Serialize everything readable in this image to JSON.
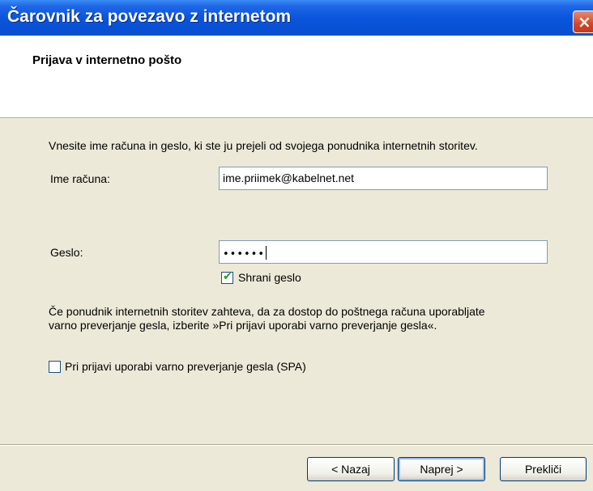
{
  "window": {
    "title": "Čarovnik za povezavo z internetom"
  },
  "header": {
    "title": "Prijava v internetno pošto"
  },
  "intro_text": "Vnesite ime računa in geslo, ki ste ju prejeli od svojega ponudnika internetnih storitev.",
  "account": {
    "label": "Ime računa:",
    "value": "ime.priimek@kabelnet.net"
  },
  "password": {
    "label": "Geslo:",
    "masked_value": "••••••"
  },
  "remember_password": {
    "label": "Shrani geslo",
    "checked": true,
    "check_glyph": "✔"
  },
  "spa_info_line1": "Če ponudnik internetnih storitev zahteva, da za dostop do poštnega računa uporabljate",
  "spa_info_line2": "varno preverjanje gesla, izberite »Pri prijavi uporabi varno preverjanje gesla«.",
  "spa_checkbox": {
    "label": "Pri prijavi uporabi varno preverjanje gesla (SPA)",
    "checked": false
  },
  "buttons": {
    "back": "< Nazaj",
    "next": "Naprej >",
    "cancel": "Prekliči"
  },
  "icons": {
    "close": "×"
  },
  "colors": {
    "titlebar": "#0a55dc",
    "dialog_bg": "#ece9d8",
    "checkmark": "#21a121"
  }
}
